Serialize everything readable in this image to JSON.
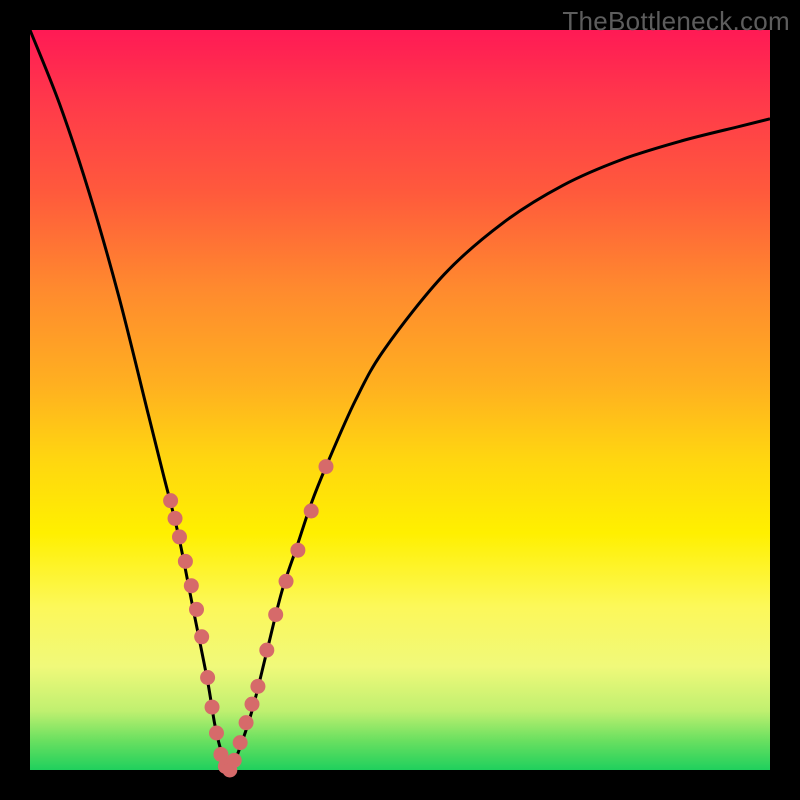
{
  "watermark": "TheBottleneck.com",
  "chart_data": {
    "type": "line",
    "title": "",
    "xlabel": "",
    "ylabel": "",
    "xlim": [
      0,
      100
    ],
    "ylim": [
      0,
      100
    ],
    "grid": false,
    "series": [
      {
        "name": "curve",
        "x": [
          0,
          4,
          8,
          12,
          16,
          18,
          20,
          22,
          24,
          25,
          26,
          27,
          28,
          30,
          32,
          34,
          36,
          38,
          40,
          44,
          48,
          56,
          64,
          72,
          80,
          88,
          96,
          100
        ],
        "y": [
          100,
          90,
          78,
          64,
          48,
          40,
          32,
          22,
          12,
          6,
          2,
          0,
          2,
          8,
          16,
          24,
          30,
          36,
          41,
          50,
          57,
          67,
          74,
          79,
          82.5,
          85,
          87,
          88
        ]
      }
    ],
    "markers": {
      "name": "highlight-points",
      "x": [
        19.0,
        19.6,
        20.2,
        21.0,
        21.8,
        22.5,
        23.2,
        24.0,
        24.6,
        25.2,
        25.8,
        26.4,
        27.0,
        27.6,
        28.4,
        29.2,
        30.0,
        30.8,
        32.0,
        33.2,
        34.6,
        36.2,
        38.0,
        40.0
      ],
      "y": [
        36.4,
        34.0,
        31.5,
        28.2,
        24.9,
        21.7,
        18.0,
        12.5,
        8.5,
        5.0,
        2.1,
        0.5,
        0.0,
        1.3,
        3.7,
        6.4,
        8.9,
        11.3,
        16.2,
        21.0,
        25.5,
        29.7,
        35.0,
        41.0
      ]
    },
    "gradient_colors": {
      "top": "#ff1a55",
      "mid": "#fff000",
      "bottom": "#1fd05d"
    },
    "background": "#000000"
  }
}
